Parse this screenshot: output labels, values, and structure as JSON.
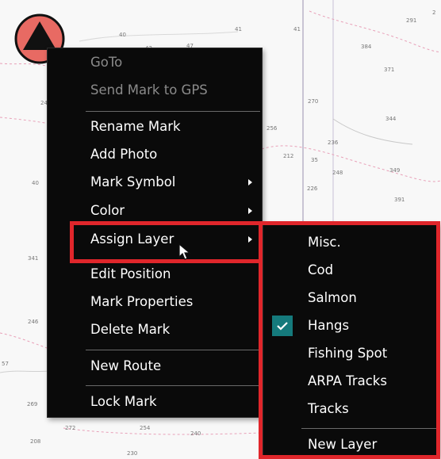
{
  "map": {
    "depth_labels": [
      "40",
      "42",
      "41",
      "47",
      "41",
      "2",
      "291",
      "384",
      "371",
      "24",
      "270",
      "344",
      "256",
      "236",
      "212",
      "35",
      "248",
      "40",
      "349",
      "226",
      "391",
      "341",
      "246",
      "57",
      "269",
      "272",
      "254",
      "240",
      "208",
      "230"
    ]
  },
  "context_menu": {
    "items": [
      {
        "label": "GoTo",
        "enabled": false
      },
      {
        "label": "Send Mark to GPS",
        "enabled": false
      },
      {
        "label": "Rename Mark",
        "enabled": true
      },
      {
        "label": "Add Photo",
        "enabled": true
      },
      {
        "label": "Mark Symbol",
        "enabled": true,
        "has_submenu": true
      },
      {
        "label": "Color",
        "enabled": true,
        "has_submenu": true
      },
      {
        "label": "Assign Layer",
        "enabled": true,
        "has_submenu": true,
        "highlighted": true
      },
      {
        "label": "Edit Position",
        "enabled": true
      },
      {
        "label": "Mark Properties",
        "enabled": true
      },
      {
        "label": "Delete Mark",
        "enabled": true
      },
      {
        "label": "New Route",
        "enabled": true
      },
      {
        "label": "Lock Mark",
        "enabled": true
      }
    ]
  },
  "layer_submenu": {
    "items": [
      {
        "label": "Misc.",
        "checked": false
      },
      {
        "label": "Cod",
        "checked": false
      },
      {
        "label": "Salmon",
        "checked": false
      },
      {
        "label": "Hangs",
        "checked": true
      },
      {
        "label": "Fishing Spot",
        "checked": false
      },
      {
        "label": "ARPA Tracks",
        "checked": false
      },
      {
        "label": "Tracks",
        "checked": false
      },
      {
        "label": "New Layer",
        "checked": false
      }
    ]
  },
  "colors": {
    "highlight_border": "#e0262b",
    "check_background": "#157a7c",
    "mark_fill": "#e86a63"
  },
  "icons": [
    "triangle-mark-icon",
    "submenu-arrow-icon",
    "checkmark-icon",
    "mouse-cursor-icon"
  ]
}
